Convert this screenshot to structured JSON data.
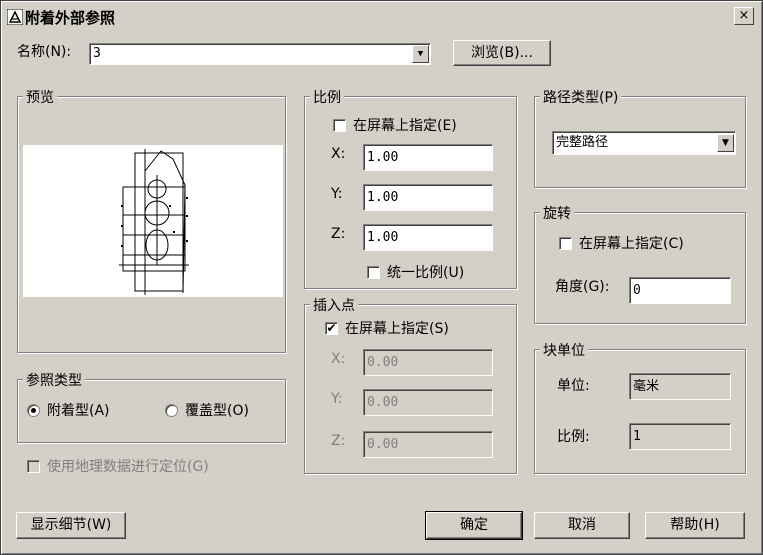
{
  "window": {
    "title": "附着外部参照",
    "close_glyph": "×"
  },
  "name": {
    "label": "名称(N):",
    "value": "3",
    "browse_label": "浏览(B)..."
  },
  "preview": {
    "title": "预览"
  },
  "scale": {
    "title": "比例",
    "specify_label": "在屏幕上指定(E)",
    "specify_checked": false,
    "x_label": "X:",
    "x_value": "1.00",
    "y_label": "Y:",
    "y_value": "1.00",
    "z_label": "Z:",
    "z_value": "1.00",
    "uniform_label": "统一比例(U)",
    "uniform_checked": false
  },
  "insertion": {
    "title": "插入点",
    "specify_label": "在屏幕上指定(S)",
    "specify_checked": true,
    "check_glyph": "✔",
    "x_label": "X:",
    "x_value": "0.00",
    "y_label": "Y:",
    "y_value": "0.00",
    "z_label": "Z:",
    "z_value": "0.00"
  },
  "path_type": {
    "title": "路径类型(P)",
    "value": "完整路径"
  },
  "rotation": {
    "title": "旋转",
    "specify_label": "在屏幕上指定(C)",
    "specify_checked": false,
    "angle_label": "角度(G):",
    "angle_value": "0"
  },
  "block_unit": {
    "title": "块单位",
    "unit_label": "单位:",
    "unit_value": "毫米",
    "scale_label": "比例:",
    "scale_value": "1"
  },
  "reference_type": {
    "title": "参照类型",
    "attach_label": "附着型(A)",
    "overlay_label": "覆盖型(O)",
    "selected": "attach"
  },
  "geo_label": "使用地理数据进行定位(G)",
  "buttons": {
    "details": "显示细节(W)",
    "ok": "确定",
    "cancel": "取消",
    "help": "帮助(H)"
  }
}
